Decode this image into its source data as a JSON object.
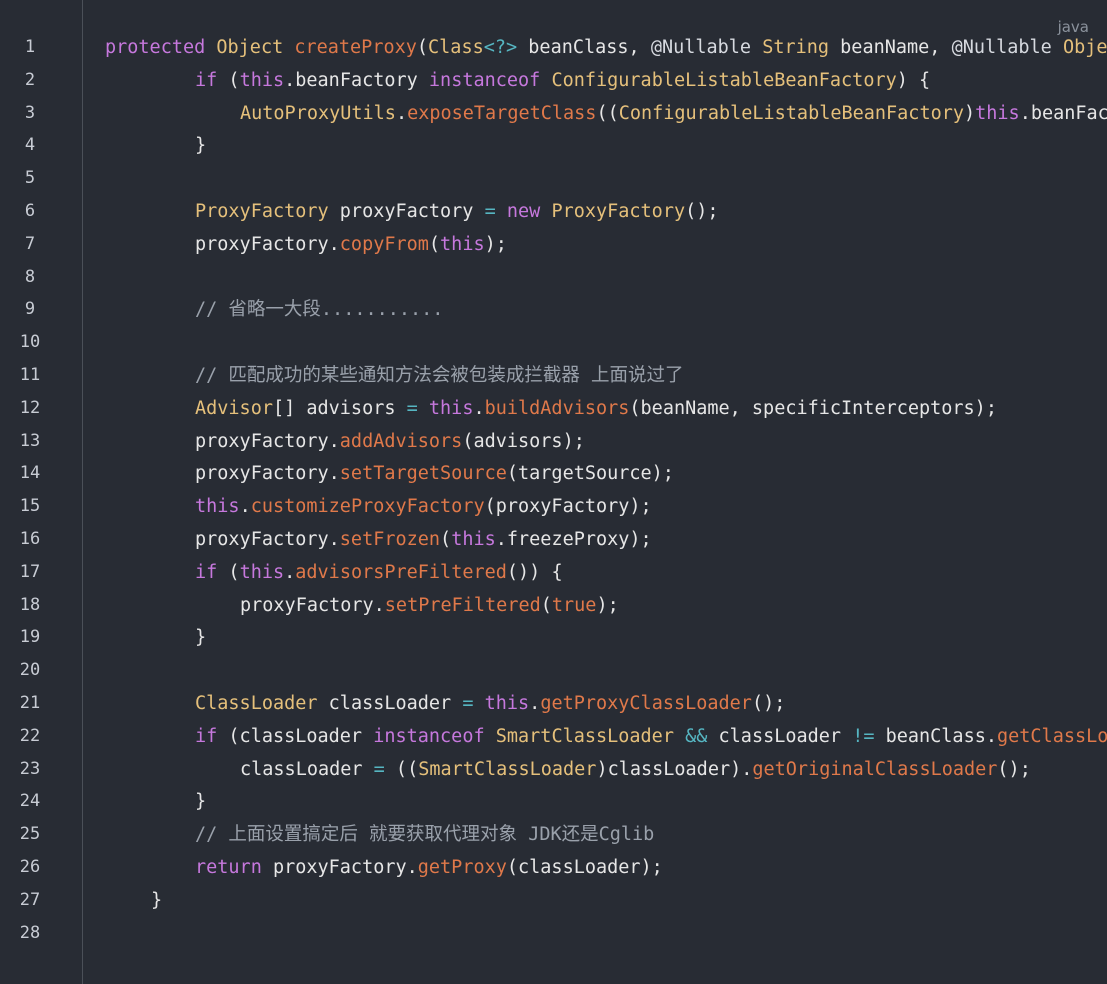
{
  "language_label": "java",
  "colors": {
    "background": "#282c34",
    "keyword": "#c678dd",
    "type": "#e5c07b",
    "function": "#e0794a",
    "operator": "#56b6c2",
    "plain": "#e6e6e6",
    "comment": "#9aa1ab",
    "line_number": "#c8ccd4"
  },
  "lines": [
    {
      "n": "1",
      "indent": 0,
      "tokens": [
        [
          "kw",
          "protected"
        ],
        [
          "p",
          " "
        ],
        [
          "type",
          "Object"
        ],
        [
          "p",
          " "
        ],
        [
          "fn",
          "createProxy"
        ],
        [
          "p",
          "("
        ],
        [
          "type",
          "Class"
        ],
        [
          "op",
          "<?>"
        ],
        [
          "p",
          " beanClass, "
        ],
        [
          "ann",
          "@Nullable"
        ],
        [
          "p",
          " "
        ],
        [
          "type",
          "String"
        ],
        [
          "p",
          " beanName, "
        ],
        [
          "ann",
          "@Nullable"
        ],
        [
          "p",
          " "
        ],
        [
          "type",
          "Object"
        ]
      ]
    },
    {
      "n": "2",
      "indent": 1,
      "tokens": [
        [
          "kw",
          "if"
        ],
        [
          "p",
          " ("
        ],
        [
          "kw",
          "this"
        ],
        [
          "p",
          ".beanFactory "
        ],
        [
          "kw",
          "instanceof"
        ],
        [
          "p",
          " "
        ],
        [
          "type",
          "ConfigurableListableBeanFactory"
        ],
        [
          "p",
          ") {"
        ]
      ]
    },
    {
      "n": "3",
      "indent": 2,
      "tokens": [
        [
          "type",
          "AutoProxyUtils"
        ],
        [
          "p",
          "."
        ],
        [
          "fn",
          "exposeTargetClass"
        ],
        [
          "p",
          "(("
        ],
        [
          "type",
          "ConfigurableListableBeanFactory"
        ],
        [
          "p",
          ")"
        ],
        [
          "kw",
          "this"
        ],
        [
          "p",
          ".beanFactory"
        ]
      ]
    },
    {
      "n": "4",
      "indent": 1,
      "tokens": [
        [
          "p",
          "}"
        ]
      ]
    },
    {
      "n": "5",
      "indent": 0,
      "tokens": []
    },
    {
      "n": "6",
      "indent": 1,
      "tokens": [
        [
          "type",
          "ProxyFactory"
        ],
        [
          "p",
          " proxyFactory "
        ],
        [
          "op",
          "="
        ],
        [
          "p",
          " "
        ],
        [
          "kw",
          "new"
        ],
        [
          "p",
          " "
        ],
        [
          "type",
          "ProxyFactory"
        ],
        [
          "p",
          "();"
        ]
      ]
    },
    {
      "n": "7",
      "indent": 1,
      "tokens": [
        [
          "p",
          "proxyFactory."
        ],
        [
          "fn",
          "copyFrom"
        ],
        [
          "p",
          "("
        ],
        [
          "kw",
          "this"
        ],
        [
          "p",
          ");"
        ]
      ]
    },
    {
      "n": "8",
      "indent": 0,
      "tokens": []
    },
    {
      "n": "9",
      "indent": 1,
      "tokens": [
        [
          "com",
          "// 省略一大段..........."
        ]
      ]
    },
    {
      "n": "10",
      "indent": 0,
      "tokens": []
    },
    {
      "n": "11",
      "indent": 1,
      "tokens": [
        [
          "com",
          "// 匹配成功的某些通知方法会被包装成拦截器 上面说过了"
        ]
      ]
    },
    {
      "n": "12",
      "indent": 1,
      "tokens": [
        [
          "type",
          "Advisor"
        ],
        [
          "p",
          "[] advisors "
        ],
        [
          "op",
          "="
        ],
        [
          "p",
          " "
        ],
        [
          "kw",
          "this"
        ],
        [
          "p",
          "."
        ],
        [
          "fn",
          "buildAdvisors"
        ],
        [
          "p",
          "(beanName, specificInterceptors);"
        ]
      ]
    },
    {
      "n": "13",
      "indent": 1,
      "tokens": [
        [
          "p",
          "proxyFactory."
        ],
        [
          "fn",
          "addAdvisors"
        ],
        [
          "p",
          "(advisors);"
        ]
      ]
    },
    {
      "n": "14",
      "indent": 1,
      "tokens": [
        [
          "p",
          "proxyFactory."
        ],
        [
          "fn",
          "setTargetSource"
        ],
        [
          "p",
          "(targetSource);"
        ]
      ]
    },
    {
      "n": "15",
      "indent": 1,
      "tokens": [
        [
          "kw",
          "this"
        ],
        [
          "p",
          "."
        ],
        [
          "fn",
          "customizeProxyFactory"
        ],
        [
          "p",
          "(proxyFactory);"
        ]
      ]
    },
    {
      "n": "16",
      "indent": 1,
      "tokens": [
        [
          "p",
          "proxyFactory."
        ],
        [
          "fn",
          "setFrozen"
        ],
        [
          "p",
          "("
        ],
        [
          "kw",
          "this"
        ],
        [
          "p",
          ".freezeProxy);"
        ]
      ]
    },
    {
      "n": "17",
      "indent": 1,
      "tokens": [
        [
          "kw",
          "if"
        ],
        [
          "p",
          " ("
        ],
        [
          "kw",
          "this"
        ],
        [
          "p",
          "."
        ],
        [
          "fn",
          "advisorsPreFiltered"
        ],
        [
          "p",
          "()) {"
        ]
      ]
    },
    {
      "n": "18",
      "indent": 2,
      "tokens": [
        [
          "p",
          "proxyFactory."
        ],
        [
          "fn",
          "setPreFiltered"
        ],
        [
          "p",
          "("
        ],
        [
          "fn",
          "true"
        ],
        [
          "p",
          ");"
        ]
      ]
    },
    {
      "n": "19",
      "indent": 1,
      "tokens": [
        [
          "p",
          "}"
        ]
      ]
    },
    {
      "n": "20",
      "indent": 0,
      "tokens": []
    },
    {
      "n": "21",
      "indent": 1,
      "tokens": [
        [
          "type",
          "ClassLoader"
        ],
        [
          "p",
          " classLoader "
        ],
        [
          "op",
          "="
        ],
        [
          "p",
          " "
        ],
        [
          "kw",
          "this"
        ],
        [
          "p",
          "."
        ],
        [
          "fn",
          "getProxyClassLoader"
        ],
        [
          "p",
          "();"
        ]
      ]
    },
    {
      "n": "22",
      "indent": 1,
      "tokens": [
        [
          "kw",
          "if"
        ],
        [
          "p",
          " (classLoader "
        ],
        [
          "kw",
          "instanceof"
        ],
        [
          "p",
          " "
        ],
        [
          "type",
          "SmartClassLoader"
        ],
        [
          "p",
          " "
        ],
        [
          "op",
          "&&"
        ],
        [
          "p",
          " classLoader "
        ],
        [
          "op",
          "!="
        ],
        [
          "p",
          " beanClass."
        ],
        [
          "fn",
          "getClassLoader"
        ]
      ]
    },
    {
      "n": "23",
      "indent": 2,
      "tokens": [
        [
          "p",
          "classLoader "
        ],
        [
          "op",
          "="
        ],
        [
          "p",
          " (("
        ],
        [
          "type",
          "SmartClassLoader"
        ],
        [
          "p",
          ")classLoader)."
        ],
        [
          "fn",
          "getOriginalClassLoader"
        ],
        [
          "p",
          "();"
        ]
      ]
    },
    {
      "n": "24",
      "indent": 1,
      "tokens": [
        [
          "p",
          "}"
        ]
      ]
    },
    {
      "n": "25",
      "indent": 1,
      "tokens": [
        [
          "com",
          "// 上面设置搞定后 就要获取代理对象 JDK还是Cglib"
        ]
      ]
    },
    {
      "n": "26",
      "indent": 1,
      "tokens": [
        [
          "kw",
          "return"
        ],
        [
          "p",
          " proxyFactory."
        ],
        [
          "fn",
          "getProxy"
        ],
        [
          "p",
          "(classLoader);"
        ]
      ]
    },
    {
      "n": "27",
      "indent": -1,
      "tokens": [
        [
          "p",
          "}"
        ]
      ]
    },
    {
      "n": "28",
      "indent": 0,
      "tokens": []
    }
  ]
}
